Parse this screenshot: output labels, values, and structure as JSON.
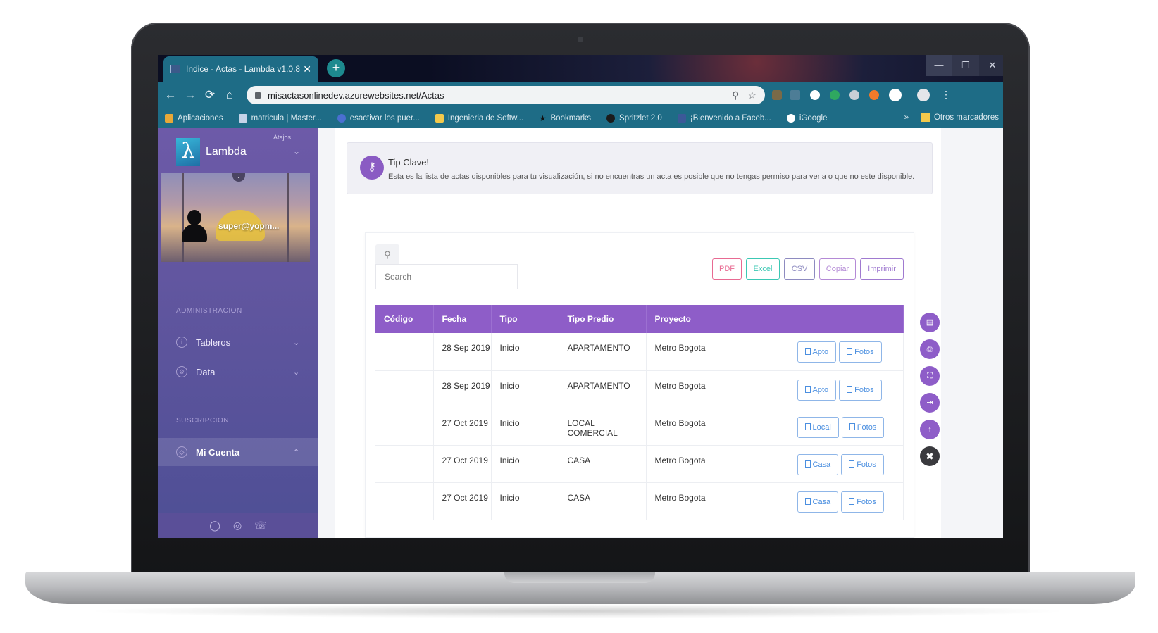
{
  "browser": {
    "tab_title": "Indice - Actas - Lambda v1.0.8",
    "tab_close": "✕",
    "new_tab": "+",
    "window_controls": {
      "minimize": "—",
      "maximize": "❐",
      "close": "✕"
    },
    "nav": {
      "back": "←",
      "forward": "→",
      "reload": "⟳",
      "home": "⌂"
    },
    "url": "misactasonlinedev.azurewebsites.net/Actas",
    "bookmarks": [
      {
        "label": "Aplicaciones",
        "icon": "apps-icon",
        "color": "#e8a838"
      },
      {
        "label": "matricula | Master...",
        "icon": "grid-icon",
        "color": "#c5d3e8"
      },
      {
        "label": "esactivar  los  puer...",
        "icon": "medal-icon",
        "color": "#4a6fd1"
      },
      {
        "label": "Ingenieria de Softw...",
        "icon": "folder-icon",
        "color": "#f2c94c"
      },
      {
        "label": "Bookmarks",
        "icon": "star-icon",
        "color": "#1b1b1b"
      },
      {
        "label": "Spritzlet 2.0",
        "icon": "globe-icon",
        "color": "#1b1b1b"
      },
      {
        "label": "¡Bienvenido a Faceb...",
        "icon": "facebook-icon",
        "color": "#3b5998"
      },
      {
        "label": "iGoogle",
        "icon": "google-icon",
        "color": "#ffffff"
      }
    ],
    "bookmarks_more": "»",
    "other_bookmarks": "Otros marcadores"
  },
  "sidebar": {
    "brand": "Lambda",
    "logo_glyph": "λ",
    "atajos": "Atajos",
    "user": "super@yopm...",
    "section_admin": "ADMINISTRACION",
    "section_subs": "SUSCRIPCION",
    "items": [
      {
        "label": "Tableros",
        "icon": "info-icon"
      },
      {
        "label": "Data",
        "icon": "gear-icon"
      },
      {
        "label": "Mi Cuenta",
        "icon": "tag-icon"
      }
    ]
  },
  "tip": {
    "title": "Tip Clave!",
    "text": "Esta es la lista de actas disponibles para tu visualización, si no encuentras un acta es posible que no tengas permiso para verla o que no este disponible."
  },
  "search": {
    "placeholder": "Search"
  },
  "export_buttons": [
    {
      "label": "PDF",
      "color": "#e86a92"
    },
    {
      "label": "Excel",
      "color": "#3cc8b4"
    },
    {
      "label": "CSV",
      "color": "#8e8bc0"
    },
    {
      "label": "Copiar",
      "color": "#b48ad6"
    },
    {
      "label": "Imprimir",
      "color": "#a07ad0"
    }
  ],
  "table": {
    "columns": [
      "Código",
      "Fecha",
      "Tipo",
      "Tipo Predio",
      "Proyecto",
      ""
    ],
    "rows": [
      {
        "codigo": "",
        "fecha": "28 Sep 2019",
        "tipo": "Inicio",
        "predio": "APARTAMENTO",
        "proyecto": "Metro Bogota",
        "btn1": "Apto",
        "btn2": "Fotos"
      },
      {
        "codigo": "",
        "fecha": "28 Sep 2019",
        "tipo": "Inicio",
        "predio": "APARTAMENTO",
        "proyecto": "Metro Bogota",
        "btn1": "Apto",
        "btn2": "Fotos"
      },
      {
        "codigo": "",
        "fecha": "27 Oct 2019",
        "tipo": "Inicio",
        "predio": "LOCAL COMERCIAL",
        "proyecto": "Metro Bogota",
        "btn1": "Local",
        "btn2": "Fotos"
      },
      {
        "codigo": "",
        "fecha": "27 Oct 2019",
        "tipo": "Inicio",
        "predio": "CASA",
        "proyecto": "Metro Bogota",
        "btn1": "Casa",
        "btn2": "Fotos"
      },
      {
        "codigo": "",
        "fecha": "27 Oct 2019",
        "tipo": "Inicio",
        "predio": "CASA",
        "proyecto": "Metro Bogota",
        "btn1": "Casa",
        "btn2": "Fotos"
      }
    ]
  },
  "fab": [
    "file-icon",
    "print-icon",
    "fullscreen-icon",
    "logout-icon",
    "arrow-up-icon",
    "close-icon"
  ]
}
